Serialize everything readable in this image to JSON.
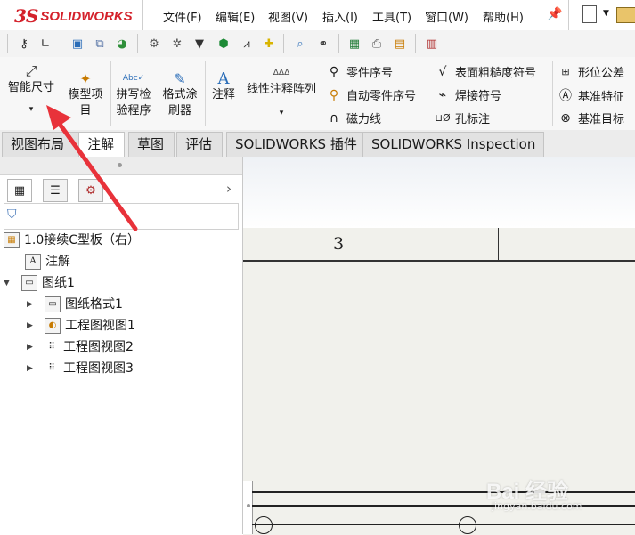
{
  "app": {
    "logo_mark": "3S",
    "logo_text": "SOLIDWORKS"
  },
  "menu": [
    "文件(F)",
    "编辑(E)",
    "视图(V)",
    "插入(I)",
    "工具(T)",
    "窗口(W)",
    "帮助(H)"
  ],
  "ribbon": {
    "smart_dimension": "智能尺寸",
    "model_items_l1": "模型项",
    "model_items_l2": "目",
    "spell_check_l1": "拼写检",
    "spell_check_l2": "验程序",
    "format_painter_l1": "格式涂",
    "format_painter_l2": "刷器",
    "note": "注释",
    "linear_note_pattern": "线性注释阵列",
    "balloon": "零件序号",
    "auto_balloon": "自动零件序号",
    "magnetic_line": "磁力线",
    "surface_finish": "表面粗糙度符号",
    "weld_symbol": "焊接符号",
    "hole_callout": "孔标注",
    "geometric_tolerance": "形位公差",
    "datum_feature": "基准特征",
    "datum_target": "基准目标"
  },
  "tabs": [
    "视图布局",
    "注解",
    "草图",
    "评估",
    "SOLIDWORKS 插件",
    "SOLIDWORKS Inspection"
  ],
  "active_tab": "注解",
  "tree": {
    "root": "1.0接续C型板（右）",
    "items": [
      "注解",
      "图纸1",
      "图纸格式1",
      "工程图视图1",
      "工程图视图2",
      "工程图视图3"
    ]
  },
  "drawing": {
    "zone_label": "3"
  },
  "watermark": {
    "main": "Bai 经验",
    "sub": "jingyan.baidu.com"
  },
  "colors": {
    "brand_red": "#d4212b",
    "arrow_red": "#e8323a",
    "tab_bg": "#e2e2e2"
  }
}
